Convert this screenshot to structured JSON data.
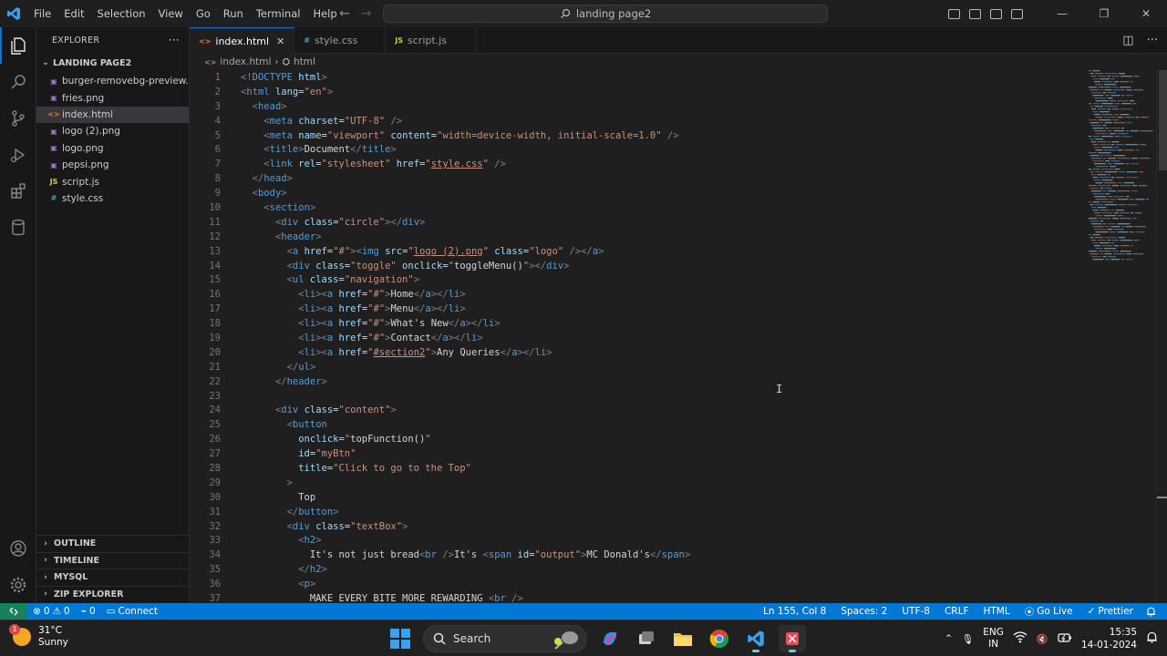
{
  "menu": [
    "File",
    "Edit",
    "Selection",
    "View",
    "Go",
    "Run",
    "Terminal",
    "Help"
  ],
  "command_center": "landing page2",
  "explorer": {
    "title": "EXPLORER",
    "more": "···",
    "folder": "LANDING PAGE2",
    "files": [
      {
        "name": "burger-removebg-preview....",
        "type": "img"
      },
      {
        "name": "fries.png",
        "type": "img"
      },
      {
        "name": "index.html",
        "type": "html"
      },
      {
        "name": "logo (2).png",
        "type": "img"
      },
      {
        "name": "logo.png",
        "type": "img"
      },
      {
        "name": "pepsi.png",
        "type": "img"
      },
      {
        "name": "script.js",
        "type": "js"
      },
      {
        "name": "style.css",
        "type": "css"
      }
    ],
    "sections": [
      "OUTLINE",
      "TIMELINE",
      "MYSQL",
      "ZIP EXPLORER"
    ]
  },
  "tabs": [
    {
      "label": "index.html",
      "icon": "<>",
      "active": true
    },
    {
      "label": "style.css",
      "icon": "#",
      "active": false
    },
    {
      "label": "script.js",
      "icon": "JS",
      "active": false
    }
  ],
  "breadcrumb": {
    "file": "index.html",
    "symbol": "html"
  },
  "code_lines": [
    [
      [
        "tg",
        "<!"
      ],
      [
        "tn",
        "DOCTYPE"
      ],
      [
        "tx",
        " "
      ],
      [
        "at",
        "html"
      ],
      [
        "tg",
        ">"
      ]
    ],
    [
      [
        "tg",
        "<"
      ],
      [
        "tn",
        "html"
      ],
      [
        "tx",
        " "
      ],
      [
        "at",
        "lang"
      ],
      [
        "tx",
        "="
      ],
      [
        "st",
        "\"en\""
      ],
      [
        "tg",
        ">"
      ]
    ],
    [
      [
        "tx",
        "  "
      ],
      [
        "tg",
        "<"
      ],
      [
        "tn",
        "head"
      ],
      [
        "tg",
        ">"
      ]
    ],
    [
      [
        "tx",
        "    "
      ],
      [
        "tg",
        "<"
      ],
      [
        "tn",
        "meta"
      ],
      [
        "tx",
        " "
      ],
      [
        "at",
        "charset"
      ],
      [
        "tx",
        "="
      ],
      [
        "st",
        "\"UTF-8\""
      ],
      [
        "tx",
        " "
      ],
      [
        "tg",
        "/>"
      ]
    ],
    [
      [
        "tx",
        "    "
      ],
      [
        "tg",
        "<"
      ],
      [
        "tn",
        "meta"
      ],
      [
        "tx",
        " "
      ],
      [
        "at",
        "name"
      ],
      [
        "tx",
        "="
      ],
      [
        "st",
        "\"viewport\""
      ],
      [
        "tx",
        " "
      ],
      [
        "at",
        "content"
      ],
      [
        "tx",
        "="
      ],
      [
        "st",
        "\"width=device-width, initial-scale=1.0\""
      ],
      [
        "tx",
        " "
      ],
      [
        "tg",
        "/>"
      ]
    ],
    [
      [
        "tx",
        "    "
      ],
      [
        "tg",
        "<"
      ],
      [
        "tn",
        "title"
      ],
      [
        "tg",
        ">"
      ],
      [
        "tx",
        "Document"
      ],
      [
        "tg",
        "</"
      ],
      [
        "tn",
        "title"
      ],
      [
        "tg",
        ">"
      ]
    ],
    [
      [
        "tx",
        "    "
      ],
      [
        "tg",
        "<"
      ],
      [
        "tn",
        "link"
      ],
      [
        "tx",
        " "
      ],
      [
        "at",
        "rel"
      ],
      [
        "tx",
        "="
      ],
      [
        "st",
        "\"stylesheet\""
      ],
      [
        "tx",
        " "
      ],
      [
        "at",
        "href"
      ],
      [
        "tx",
        "="
      ],
      [
        "st",
        "\""
      ],
      [
        "stu",
        "style.css"
      ],
      [
        "st",
        "\""
      ],
      [
        "tx",
        " "
      ],
      [
        "tg",
        "/>"
      ]
    ],
    [
      [
        "tx",
        "  "
      ],
      [
        "tg",
        "</"
      ],
      [
        "tn",
        "head"
      ],
      [
        "tg",
        ">"
      ]
    ],
    [
      [
        "tx",
        "  "
      ],
      [
        "tg",
        "<"
      ],
      [
        "tn",
        "body"
      ],
      [
        "tg",
        ">"
      ]
    ],
    [
      [
        "tx",
        "    "
      ],
      [
        "tg",
        "<"
      ],
      [
        "tn",
        "section"
      ],
      [
        "tg",
        ">"
      ]
    ],
    [
      [
        "tx",
        "      "
      ],
      [
        "tg",
        "<"
      ],
      [
        "tn",
        "div"
      ],
      [
        "tx",
        " "
      ],
      [
        "at",
        "class"
      ],
      [
        "tx",
        "="
      ],
      [
        "st",
        "\"circle\""
      ],
      [
        "tg",
        "></"
      ],
      [
        "tn",
        "div"
      ],
      [
        "tg",
        ">"
      ]
    ],
    [
      [
        "tx",
        "      "
      ],
      [
        "tg",
        "<"
      ],
      [
        "tn",
        "header"
      ],
      [
        "tg",
        ">"
      ]
    ],
    [
      [
        "tx",
        "        "
      ],
      [
        "tg",
        "<"
      ],
      [
        "tn",
        "a"
      ],
      [
        "tx",
        " "
      ],
      [
        "at",
        "href"
      ],
      [
        "tx",
        "="
      ],
      [
        "st",
        "\"#\""
      ],
      [
        "tg",
        "><"
      ],
      [
        "tn",
        "img"
      ],
      [
        "tx",
        " "
      ],
      [
        "at",
        "src"
      ],
      [
        "tx",
        "="
      ],
      [
        "st",
        "\""
      ],
      [
        "stu",
        "logo (2).png"
      ],
      [
        "st",
        "\""
      ],
      [
        "tx",
        " "
      ],
      [
        "at",
        "class"
      ],
      [
        "tx",
        "="
      ],
      [
        "st",
        "\"logo\""
      ],
      [
        "tx",
        " "
      ],
      [
        "tg",
        "/></"
      ],
      [
        "tn",
        "a"
      ],
      [
        "tg",
        ">"
      ]
    ],
    [
      [
        "tx",
        "        "
      ],
      [
        "tg",
        "<"
      ],
      [
        "tn",
        "div"
      ],
      [
        "tx",
        " "
      ],
      [
        "at",
        "class"
      ],
      [
        "tx",
        "="
      ],
      [
        "st",
        "\"toggle\""
      ],
      [
        "tx",
        " "
      ],
      [
        "at",
        "onclick"
      ],
      [
        "tx",
        "="
      ],
      [
        "st",
        "\""
      ],
      [
        "tx",
        "toggleMenu()"
      ],
      [
        "st",
        "\""
      ],
      [
        "tg",
        "></"
      ],
      [
        "tn",
        "div"
      ],
      [
        "tg",
        ">"
      ]
    ],
    [
      [
        "tx",
        "        "
      ],
      [
        "tg",
        "<"
      ],
      [
        "tn",
        "ul"
      ],
      [
        "tx",
        " "
      ],
      [
        "at",
        "class"
      ],
      [
        "tx",
        "="
      ],
      [
        "st",
        "\"navigation\""
      ],
      [
        "tg",
        ">"
      ]
    ],
    [
      [
        "tx",
        "          "
      ],
      [
        "tg",
        "<"
      ],
      [
        "tn",
        "li"
      ],
      [
        "tg",
        "><"
      ],
      [
        "tn",
        "a"
      ],
      [
        "tx",
        " "
      ],
      [
        "at",
        "href"
      ],
      [
        "tx",
        "="
      ],
      [
        "st",
        "\"#\""
      ],
      [
        "tg",
        ">"
      ],
      [
        "tx",
        "Home"
      ],
      [
        "tg",
        "</"
      ],
      [
        "tn",
        "a"
      ],
      [
        "tg",
        "></"
      ],
      [
        "tn",
        "li"
      ],
      [
        "tg",
        ">"
      ]
    ],
    [
      [
        "tx",
        "          "
      ],
      [
        "tg",
        "<"
      ],
      [
        "tn",
        "li"
      ],
      [
        "tg",
        "><"
      ],
      [
        "tn",
        "a"
      ],
      [
        "tx",
        " "
      ],
      [
        "at",
        "href"
      ],
      [
        "tx",
        "="
      ],
      [
        "st",
        "\"#\""
      ],
      [
        "tg",
        ">"
      ],
      [
        "tx",
        "Menu"
      ],
      [
        "tg",
        "</"
      ],
      [
        "tn",
        "a"
      ],
      [
        "tg",
        "></"
      ],
      [
        "tn",
        "li"
      ],
      [
        "tg",
        ">"
      ]
    ],
    [
      [
        "tx",
        "          "
      ],
      [
        "tg",
        "<"
      ],
      [
        "tn",
        "li"
      ],
      [
        "tg",
        "><"
      ],
      [
        "tn",
        "a"
      ],
      [
        "tx",
        " "
      ],
      [
        "at",
        "href"
      ],
      [
        "tx",
        "="
      ],
      [
        "st",
        "\"#\""
      ],
      [
        "tg",
        ">"
      ],
      [
        "tx",
        "What's New"
      ],
      [
        "tg",
        "</"
      ],
      [
        "tn",
        "a"
      ],
      [
        "tg",
        "></"
      ],
      [
        "tn",
        "li"
      ],
      [
        "tg",
        ">"
      ]
    ],
    [
      [
        "tx",
        "          "
      ],
      [
        "tg",
        "<"
      ],
      [
        "tn",
        "li"
      ],
      [
        "tg",
        "><"
      ],
      [
        "tn",
        "a"
      ],
      [
        "tx",
        " "
      ],
      [
        "at",
        "href"
      ],
      [
        "tx",
        "="
      ],
      [
        "st",
        "\"#\""
      ],
      [
        "tg",
        ">"
      ],
      [
        "tx",
        "Contact"
      ],
      [
        "tg",
        "</"
      ],
      [
        "tn",
        "a"
      ],
      [
        "tg",
        "></"
      ],
      [
        "tn",
        "li"
      ],
      [
        "tg",
        ">"
      ]
    ],
    [
      [
        "tx",
        "          "
      ],
      [
        "tg",
        "<"
      ],
      [
        "tn",
        "li"
      ],
      [
        "tg",
        "><"
      ],
      [
        "tn",
        "a"
      ],
      [
        "tx",
        " "
      ],
      [
        "at",
        "href"
      ],
      [
        "tx",
        "="
      ],
      [
        "st",
        "\""
      ],
      [
        "stu",
        "#section2"
      ],
      [
        "st",
        "\""
      ],
      [
        "tg",
        ">"
      ],
      [
        "tx",
        "Any Queries"
      ],
      [
        "tg",
        "</"
      ],
      [
        "tn",
        "a"
      ],
      [
        "tg",
        "></"
      ],
      [
        "tn",
        "li"
      ],
      [
        "tg",
        ">"
      ]
    ],
    [
      [
        "tx",
        "        "
      ],
      [
        "tg",
        "</"
      ],
      [
        "tn",
        "ul"
      ],
      [
        "tg",
        ">"
      ]
    ],
    [
      [
        "tx",
        "      "
      ],
      [
        "tg",
        "</"
      ],
      [
        "tn",
        "header"
      ],
      [
        "tg",
        ">"
      ]
    ],
    [],
    [
      [
        "tx",
        "      "
      ],
      [
        "tg",
        "<"
      ],
      [
        "tn",
        "div"
      ],
      [
        "tx",
        " "
      ],
      [
        "at",
        "class"
      ],
      [
        "tx",
        "="
      ],
      [
        "st",
        "\"content\""
      ],
      [
        "tg",
        ">"
      ]
    ],
    [
      [
        "tx",
        "        "
      ],
      [
        "tg",
        "<"
      ],
      [
        "tn",
        "button"
      ]
    ],
    [
      [
        "tx",
        "          "
      ],
      [
        "at",
        "onclick"
      ],
      [
        "tx",
        "="
      ],
      [
        "st",
        "\""
      ],
      [
        "tx",
        "topFunction()"
      ],
      [
        "st",
        "\""
      ]
    ],
    [
      [
        "tx",
        "          "
      ],
      [
        "at",
        "id"
      ],
      [
        "tx",
        "="
      ],
      [
        "st",
        "\"myBtn\""
      ]
    ],
    [
      [
        "tx",
        "          "
      ],
      [
        "at",
        "title"
      ],
      [
        "tx",
        "="
      ],
      [
        "st",
        "\"Click to go to the Top\""
      ]
    ],
    [
      [
        "tx",
        "        "
      ],
      [
        "tg",
        ">"
      ]
    ],
    [
      [
        "tx",
        "          Top"
      ]
    ],
    [
      [
        "tx",
        "        "
      ],
      [
        "tg",
        "</"
      ],
      [
        "tn",
        "button"
      ],
      [
        "tg",
        ">"
      ]
    ],
    [
      [
        "tx",
        "        "
      ],
      [
        "tg",
        "<"
      ],
      [
        "tn",
        "div"
      ],
      [
        "tx",
        " "
      ],
      [
        "at",
        "class"
      ],
      [
        "tx",
        "="
      ],
      [
        "st",
        "\"textBox\""
      ],
      [
        "tg",
        ">"
      ]
    ],
    [
      [
        "tx",
        "          "
      ],
      [
        "tg",
        "<"
      ],
      [
        "tn",
        "h2"
      ],
      [
        "tg",
        ">"
      ]
    ],
    [
      [
        "tx",
        "            It's not just bread"
      ],
      [
        "tg",
        "<"
      ],
      [
        "tn",
        "br"
      ],
      [
        "tx",
        " "
      ],
      [
        "tg",
        "/>"
      ],
      [
        "tx",
        "It's "
      ],
      [
        "tg",
        "<"
      ],
      [
        "tn",
        "span"
      ],
      [
        "tx",
        " "
      ],
      [
        "at",
        "id"
      ],
      [
        "tx",
        "="
      ],
      [
        "st",
        "\"output\""
      ],
      [
        "tg",
        ">"
      ],
      [
        "tx",
        "MC Donald's"
      ],
      [
        "tg",
        "</"
      ],
      [
        "tn",
        "span"
      ],
      [
        "tg",
        ">"
      ]
    ],
    [
      [
        "tx",
        "          "
      ],
      [
        "tg",
        "</"
      ],
      [
        "tn",
        "h2"
      ],
      [
        "tg",
        ">"
      ]
    ],
    [
      [
        "tx",
        "          "
      ],
      [
        "tg",
        "<"
      ],
      [
        "tn",
        "p"
      ],
      [
        "tg",
        ">"
      ]
    ],
    [
      [
        "tx",
        "            MAKE EVERY BITE MORE REWARDING "
      ],
      [
        "tg",
        "<"
      ],
      [
        "tn",
        "br"
      ],
      [
        "tx",
        " "
      ],
      [
        "tg",
        "/>"
      ]
    ]
  ],
  "status": {
    "errors": "0",
    "warnings": "0",
    "ports": "0",
    "connect": "Connect",
    "position": "Ln 155, Col 8",
    "spaces": "Spaces: 2",
    "encoding": "UTF-8",
    "eol": "CRLF",
    "language": "HTML",
    "golive": "Go Live",
    "prettier": "Prettier"
  },
  "taskbar": {
    "temp": "31°C",
    "condition": "Sunny",
    "badge": "1",
    "search": "Search",
    "lang1": "ENG",
    "lang2": "IN",
    "time": "15:35",
    "date": "14-01-2024"
  },
  "colors": {
    "accent": "#0078d4",
    "remote": "#16825d",
    "tag": "#569cd6",
    "attr": "#9cdcfe",
    "string": "#ce9178"
  }
}
